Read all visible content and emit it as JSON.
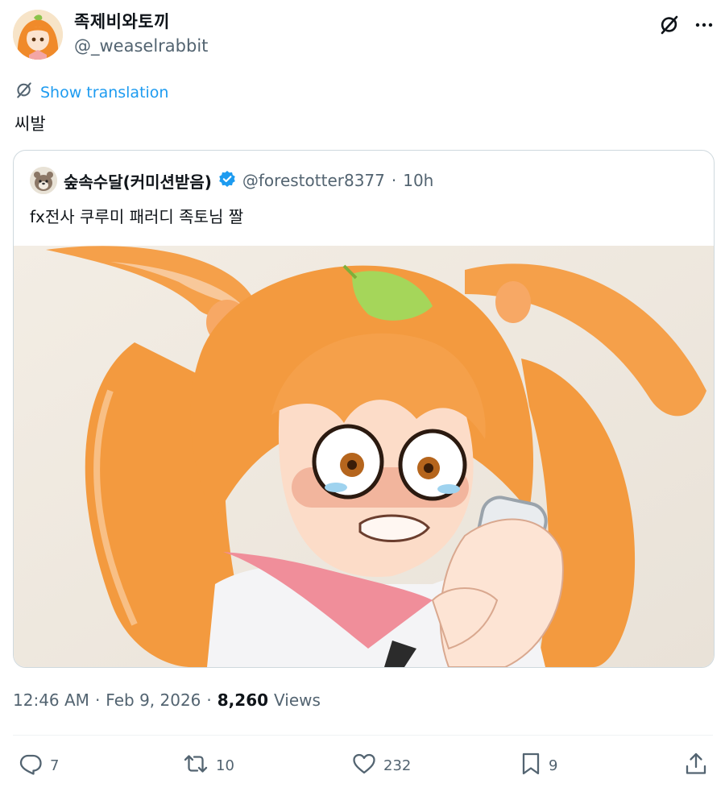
{
  "author": {
    "name": "족제비와토끼",
    "handle": "@_weaselrabbit"
  },
  "translation_label": "Show translation",
  "tweet_text": "씨발",
  "quote": {
    "name": "숲속수달(커미션받음)",
    "verified": true,
    "handle": "@forestotter8377",
    "separator": "·",
    "time": "10h",
    "text": "fx전사 쿠루미 패러디 족토님 짤"
  },
  "meta": {
    "time": "12:46 AM",
    "dot1": "·",
    "date": "Feb 9, 2026",
    "dot2": "·",
    "views_count": "8,260",
    "views_label": "Views"
  },
  "actions": {
    "replies": "7",
    "reposts": "10",
    "likes": "232",
    "bookmarks": "9"
  },
  "icons": [
    "grok-icon",
    "more-icon",
    "translate-icon",
    "verified-badge-icon",
    "reply-icon",
    "repost-icon",
    "like-icon",
    "bookmark-icon",
    "share-icon"
  ],
  "colors": {
    "accent": "#1d9bf0",
    "text": "#0f1419",
    "secondary": "#536471",
    "border": "#cfd9de"
  }
}
